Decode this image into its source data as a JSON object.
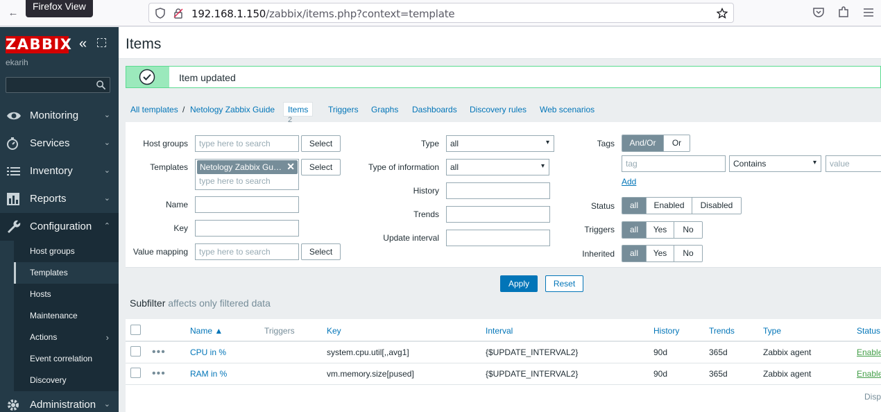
{
  "browser": {
    "tooltip": "Firefox View",
    "url_host": "192.168.1.150",
    "url_path": "/zabbix/items.php?context=template"
  },
  "sidebar": {
    "logo": "ZABBIX",
    "username": "ekarih",
    "search_value": "",
    "menu": [
      {
        "label": "Monitoring",
        "icon": "eye-icon"
      },
      {
        "label": "Services",
        "icon": "clock-icon"
      },
      {
        "label": "Inventory",
        "icon": "list-icon"
      },
      {
        "label": "Reports",
        "icon": "bar-chart-icon"
      },
      {
        "label": "Configuration",
        "icon": "wrench-icon"
      },
      {
        "label": "Administration",
        "icon": "gear-icon"
      }
    ],
    "submenu": [
      "Host groups",
      "Templates",
      "Hosts",
      "Maintenance",
      "Actions",
      "Event correlation",
      "Discovery"
    ]
  },
  "header": {
    "title": "Items"
  },
  "message": {
    "text": "Item updated"
  },
  "breadcrumbs": {
    "all_templates": "All templates",
    "template": "Netology Zabbix Guide",
    "items": "Items",
    "items_count": "2",
    "tabs": [
      "Triggers",
      "Graphs",
      "Dashboards",
      "Discovery rules",
      "Web scenarios"
    ]
  },
  "filter": {
    "host_groups_label": "Host groups",
    "templates_label": "Templates",
    "name_label": "Name",
    "key_label": "Key",
    "value_mapping_label": "Value mapping",
    "search_placeholder": "type here to search",
    "select_label": "Select",
    "template_chip": "Netology Zabbix Gu…",
    "type_label": "Type",
    "type_value": "all",
    "type_info_label": "Type of information",
    "type_info_value": "all",
    "history_label": "History",
    "trends_label": "Trends",
    "update_interval_label": "Update interval",
    "tags_label": "Tags",
    "tags_andor": "And/Or",
    "tags_or": "Or",
    "tag_placeholder": "tag",
    "tag_operator": "Contains",
    "value_placeholder": "value",
    "add_label": "Add",
    "status_label": "Status",
    "status_options": [
      "all",
      "Enabled",
      "Disabled"
    ],
    "triggers_label": "Triggers",
    "inherited_label": "Inherited",
    "yesno_options": [
      "all",
      "Yes",
      "No"
    ],
    "apply": "Apply",
    "reset": "Reset"
  },
  "subfilter": {
    "title": "Subfilter",
    "note": "affects only filtered data"
  },
  "table": {
    "headers": {
      "name": "Name ▲",
      "triggers": "Triggers",
      "key": "Key",
      "interval": "Interval",
      "history": "History",
      "trends": "Trends",
      "type": "Type",
      "status": "Status"
    },
    "rows": [
      {
        "name": "CPU in %",
        "key": "system.cpu.util[,,avg1]",
        "interval": "{$UPDATE_INTERVAL2}",
        "history": "90d",
        "trends": "365d",
        "type": "Zabbix agent",
        "status": "Enabled"
      },
      {
        "name": "RAM in %",
        "key": "vm.memory.size[pused]",
        "interval": "{$UPDATE_INTERVAL2}",
        "history": "90d",
        "trends": "365d",
        "type": "Zabbix agent",
        "status": "Enabled"
      }
    ],
    "footer": "Disp"
  }
}
